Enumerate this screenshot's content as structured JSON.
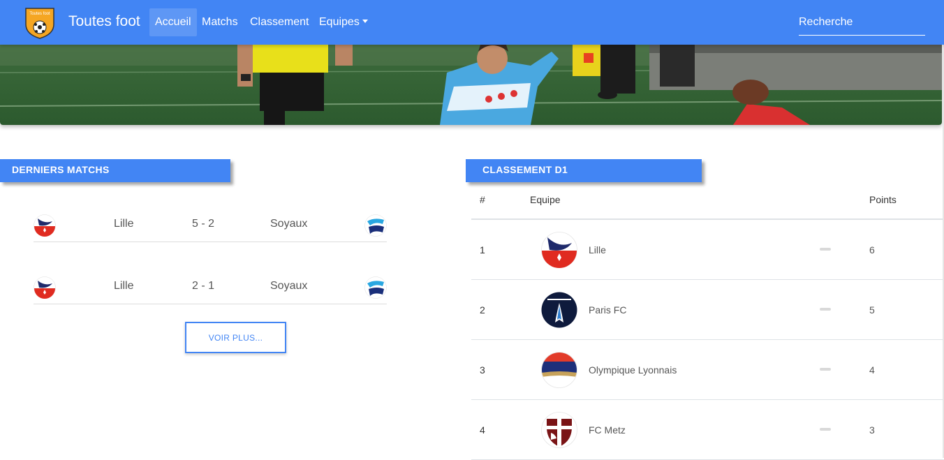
{
  "navbar": {
    "logo_text": "Toutes foot",
    "brand": "Toutes foot",
    "items": [
      {
        "label": "Accueil",
        "active": true
      },
      {
        "label": "Matchs",
        "active": false
      },
      {
        "label": "Classement",
        "active": false
      },
      {
        "label": "Equipes",
        "active": false,
        "dropdown": true
      }
    ],
    "search_placeholder": "Recherche",
    "color": "#4285f4"
  },
  "last_matches": {
    "title": "DERNIERS MATCHS",
    "matches": [
      {
        "home": "Lille",
        "score": "5 - 2",
        "away": "Soyaux",
        "home_icon": "lille-logo-icon",
        "away_icon": "soyaux-logo-icon"
      },
      {
        "home": "Lille",
        "score": "2 - 1",
        "away": "Soyaux",
        "home_icon": "lille-logo-icon",
        "away_icon": "soyaux-logo-icon"
      }
    ],
    "more_button": "VOIR PLUS..."
  },
  "standings": {
    "title": "CLASSEMENT D1",
    "columns": {
      "rank": "#",
      "team": "Equipe",
      "points": "Points"
    },
    "rows": [
      {
        "rank": "1",
        "team": "Lille",
        "points": "6",
        "icon": "lille-logo-icon"
      },
      {
        "rank": "2",
        "team": "Paris FC",
        "points": "5",
        "icon": "paris-fc-logo-icon"
      },
      {
        "rank": "3",
        "team": "Olympique Lyonnais",
        "points": "4",
        "icon": "lyon-logo-icon"
      },
      {
        "rank": "4",
        "team": "FC Metz",
        "points": "3",
        "icon": "metz-logo-icon"
      }
    ]
  }
}
